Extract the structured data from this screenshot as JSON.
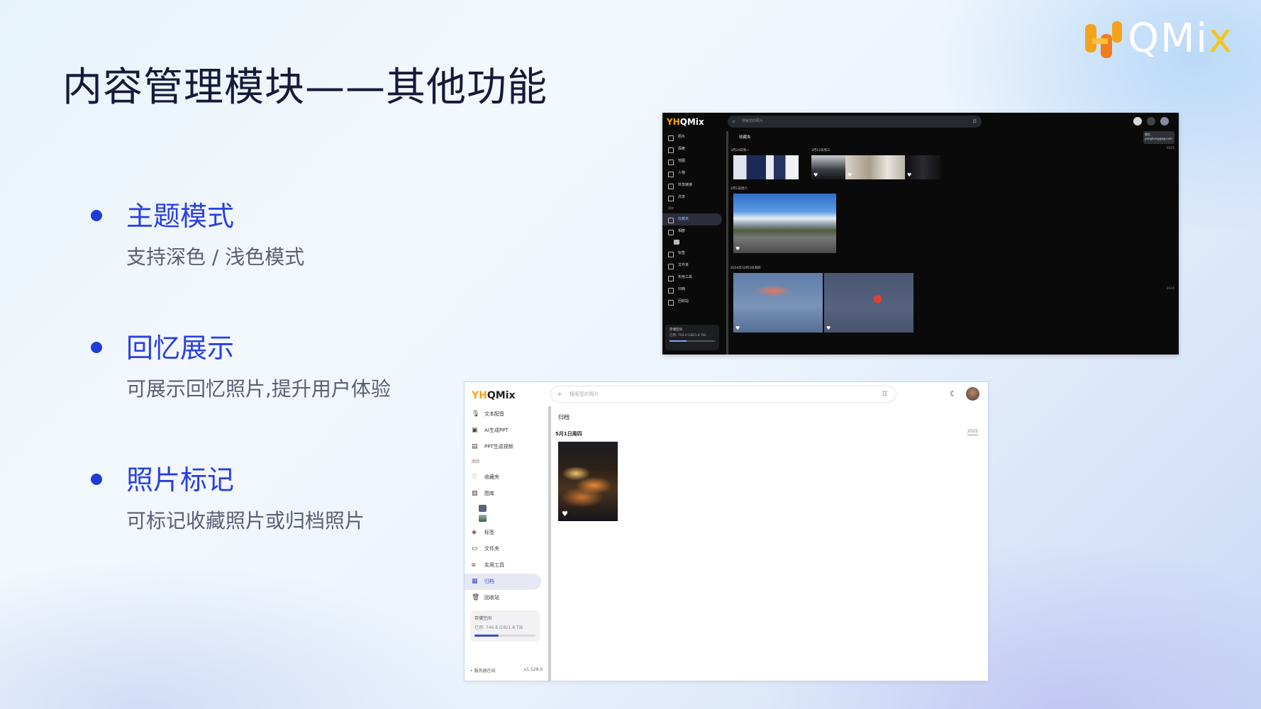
{
  "slide": {
    "title": "内容管理模块——其他功能",
    "brand": {
      "prefix": "YH",
      "name": "QMix",
      "colors": {
        "yellow": "#f5a21b",
        "orange": "#f07c1e",
        "white": "#ffffff"
      }
    }
  },
  "bullets": [
    {
      "heading": "主题模式",
      "desc": "支持深色 / 浅色模式"
    },
    {
      "heading": "回忆展示",
      "desc": "可展示回忆照片,提升用户体验"
    },
    {
      "heading": "照片标记",
      "desc": "可标记收藏照片或归档照片"
    }
  ],
  "dark_app": {
    "logo": "QMix",
    "logo_prefix": "YH",
    "search_placeholder": "搜索您的照片",
    "tooltip": {
      "name": "微信",
      "email": "yanghong@qq.com"
    },
    "page_title": "收藏夹",
    "sidebar": [
      {
        "label": "照片"
      },
      {
        "label": "探索"
      },
      {
        "label": "地图"
      },
      {
        "label": "人物"
      },
      {
        "label": "共享链接"
      },
      {
        "label": "共享"
      }
    ],
    "section_label": "图库",
    "sidebar2": [
      {
        "label": "收藏夹",
        "active": true
      },
      {
        "label": "相册"
      },
      {
        "label": "标签"
      },
      {
        "label": "文件夹"
      },
      {
        "label": "实用工具"
      },
      {
        "label": "归档"
      },
      {
        "label": "回收站"
      }
    ],
    "storage": {
      "title": "存储空间",
      "usage": "已用: 704.0 GiB/1.8 TiB",
      "fraction": 0.38
    },
    "groups": [
      {
        "date": "3月24日周一"
      },
      {
        "date": "3月12日周三"
      },
      {
        "date": "2月1日周六"
      },
      {
        "date": "2024年10月3日周四"
      }
    ],
    "timeline_years": [
      "2025",
      "2024"
    ]
  },
  "light_app": {
    "logo": "QMix",
    "logo_prefix": "YH",
    "search_placeholder": "搜索您的照片",
    "sidebar": [
      {
        "label": "文本配音",
        "icon": "microphone-icon"
      },
      {
        "label": "AI生成PPT",
        "icon": "ppt-icon"
      },
      {
        "label": "PPT生成视频",
        "icon": "video-icon"
      }
    ],
    "section_label": "图库",
    "sidebar2": [
      {
        "label": "收藏夹",
        "icon": "heart-icon"
      },
      {
        "label": "图库",
        "icon": "album-icon"
      }
    ],
    "sidebar3": [
      {
        "label": "标签",
        "icon": "tag-icon"
      },
      {
        "label": "文件夹",
        "icon": "folder-icon"
      },
      {
        "label": "实用工具",
        "icon": "toolbox-icon"
      },
      {
        "label": "归档",
        "icon": "archive-icon",
        "active": true
      },
      {
        "label": "回收站",
        "icon": "trash-icon"
      }
    ],
    "storage": {
      "title": "存储空间",
      "usage": "已用: 746.8 GiB/1.8 TiB",
      "fraction": 0.4
    },
    "footer": {
      "status": "服务器在线",
      "version": "v1.129.0"
    },
    "page_title": "归档",
    "group_date": "5月1日周四",
    "timeline_year": "2025"
  }
}
